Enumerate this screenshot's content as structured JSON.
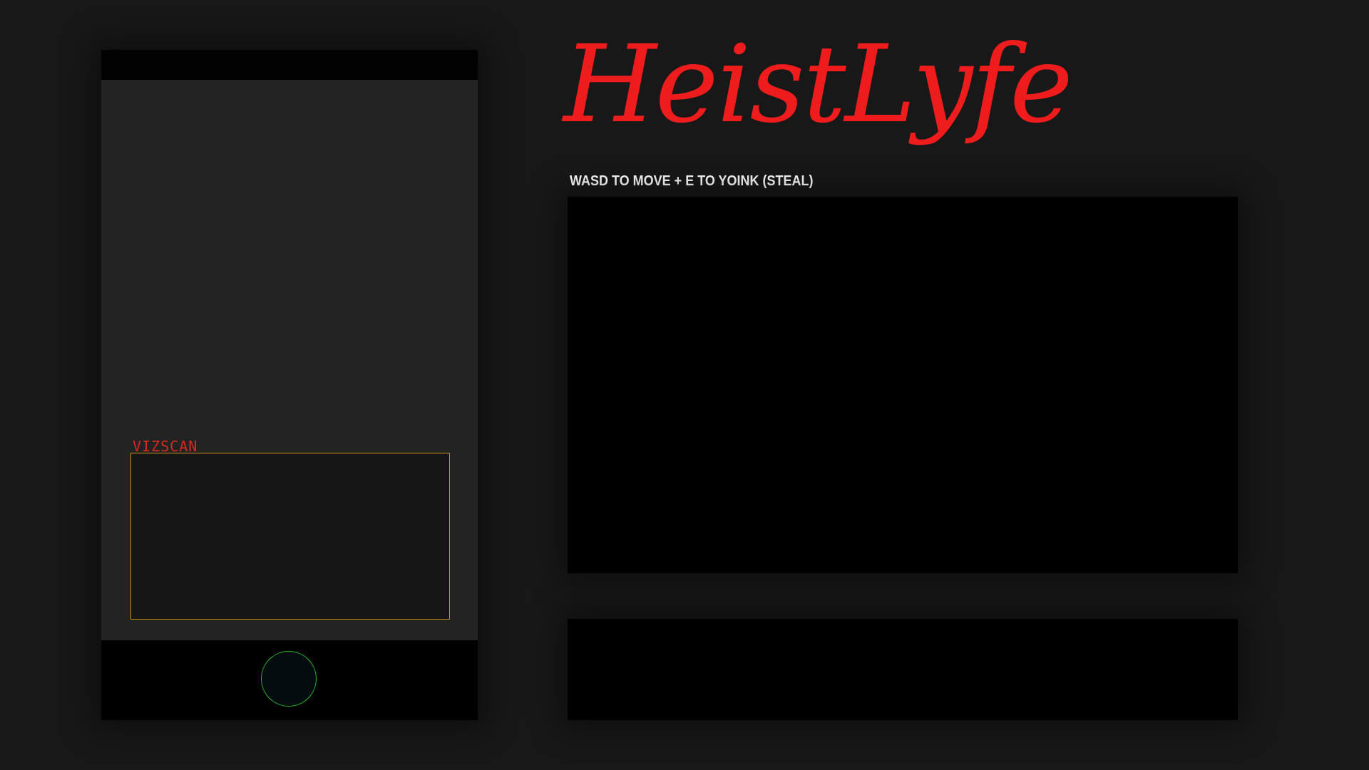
{
  "title": {
    "text": "HeistLyfe",
    "color": "#ee1c1c"
  },
  "instructions": {
    "text": "WASD TO MOVE + E TO YOINK (STEAL)"
  },
  "phone": {
    "vizscan_label": "VIZSCAN",
    "vizscan_label_color": "#d42a1e",
    "vizscan_border_color": "#c9901f",
    "home_button_icon": "circle-button-icon",
    "home_button_border_color": "#2bb52b"
  }
}
